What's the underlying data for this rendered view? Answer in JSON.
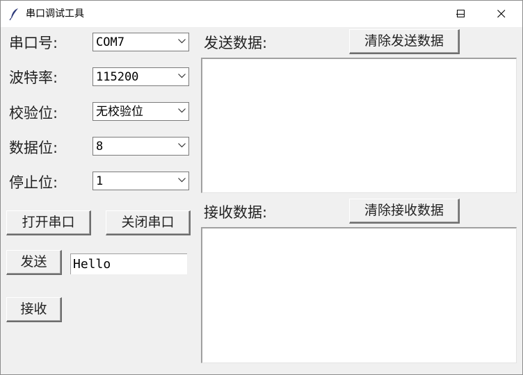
{
  "window": {
    "title": "串口调试工具",
    "controls": {
      "minimize": "minimize-icon",
      "maximize": "maximize-icon",
      "close": "close-icon"
    }
  },
  "settings": {
    "port": {
      "label": "串口号:",
      "value": "COM7"
    },
    "baud": {
      "label": "波特率:",
      "value": "115200"
    },
    "parity": {
      "label": "校验位:",
      "value": "无校验位"
    },
    "databits": {
      "label": "数据位:",
      "value": "8"
    },
    "stopbits": {
      "label": "停止位:",
      "value": "1"
    }
  },
  "buttons": {
    "open": "打开串口",
    "close": "关闭串口",
    "send": "发送",
    "receive": "接收"
  },
  "send_input": {
    "value": "Hello"
  },
  "send_panel": {
    "label": "发送数据:",
    "clear_label": "清除发送数据",
    "content": ""
  },
  "receive_panel": {
    "label": "接收数据:",
    "clear_label": "清除接收数据",
    "content": ""
  },
  "icons": {
    "app": "feather-icon",
    "dropdown": "chevron-down-icon"
  }
}
